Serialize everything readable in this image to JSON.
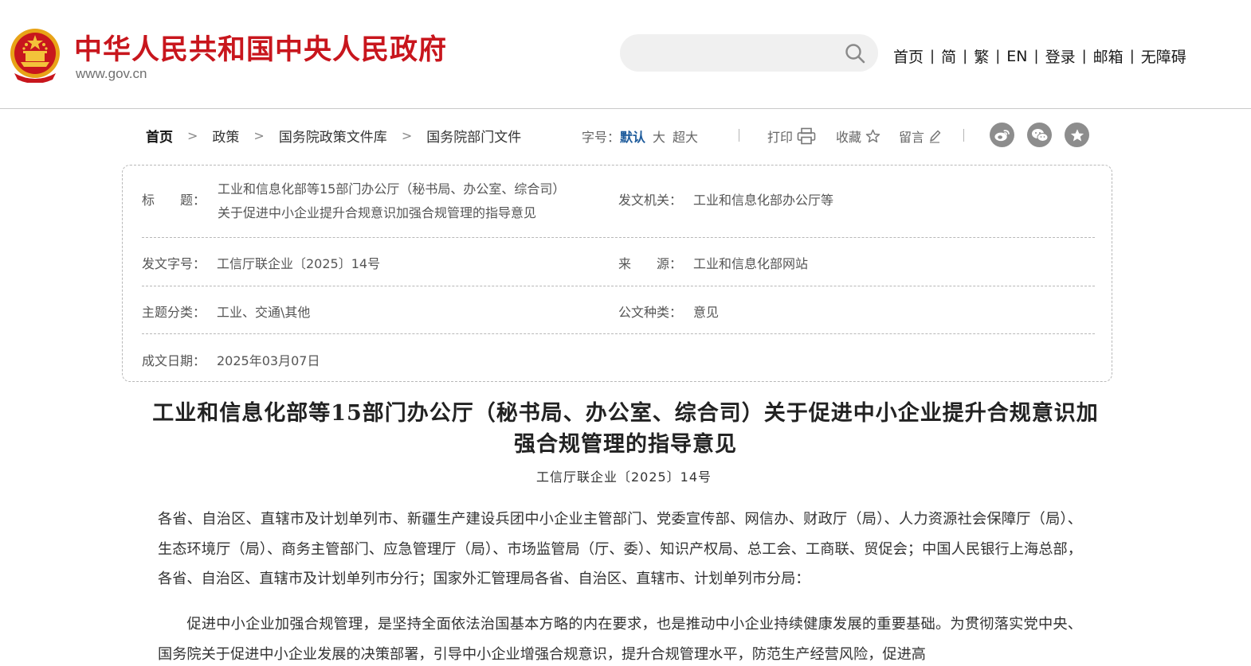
{
  "header": {
    "site_title": "中华人民共和国中央人民政府",
    "site_url": "www.gov.cn",
    "search": {
      "value": "",
      "placeholder": ""
    },
    "nav": [
      "首页",
      "简",
      "繁",
      "EN",
      "登录",
      "邮箱",
      "无障碍"
    ],
    "nav_separator": "|"
  },
  "toolbar": {
    "breadcrumb": [
      "首页",
      "政策",
      "国务院政策文件库",
      "国务院部门文件"
    ],
    "breadcrumb_separator": ">",
    "fontsize_label": "字号：",
    "fontsize_options": [
      "默认",
      "大",
      "超大"
    ],
    "print_label": "打印",
    "favorite_label": "收藏",
    "comment_label": "留言"
  },
  "info": {
    "title_label": "标　　题：",
    "title_line1": "工业和信息化部等15部门办公厅（秘书局、办公室、综合司）",
    "title_line2": "关于促进中小企业提升合规意识加强合规管理的指导意见",
    "issuer_label": "发文机关：",
    "issuer": "工业和信息化部办公厅等",
    "docno_label": "发文字号：",
    "docno": "工信厅联企业〔2025〕14号",
    "source_label": "来　　源：",
    "source": "工业和信息化部网站",
    "topic_label": "主题分类：",
    "topic": "工业、交通\\其他",
    "doctype_label": "公文种类：",
    "doctype": "意见",
    "date_label": "成文日期：",
    "date": "2025年03月07日"
  },
  "article": {
    "title": "工业和信息化部等15部门办公厅（秘书局、办公室、综合司）关于促进中小企业提升合规意识加强合规管理的指导意见",
    "doc_number": "工信厅联企业〔2025〕14号",
    "paragraph1": "各省、自治区、直辖市及计划单列市、新疆生产建设兵团中小企业主管部门、党委宣传部、网信办、财政厅（局）、人力资源社会保障厅（局）、生态环境厅（局）、商务主管部门、应急管理厅（局）、市场监管局（厅、委）、知识产权局、总工会、工商联、贸促会；中国人民银行上海总部，各省、自治区、直辖市及计划单列市分行；国家外汇管理局各省、自治区、直辖市、计划单列市分局：",
    "paragraph2": "促进中小企业加强合规管理，是坚持全面依法治国基本方略的内在要求，也是推动中小企业持续健康发展的重要基础。为贯彻落实党中央、国务院关于促进中小企业发展的决策部署，引导中小企业增强合规意识，提升合规管理水平，防范生产经营风险，促进高"
  },
  "colors": {
    "brand_red": "#c8161d",
    "link_blue": "#1f5c9c",
    "share_gray": "#8d8d8d"
  },
  "icons": [
    "national-emblem-icon",
    "search-icon",
    "print-icon",
    "star-icon",
    "pencil-icon",
    "weibo-icon",
    "wechat-icon",
    "favorite-share-icon"
  ]
}
